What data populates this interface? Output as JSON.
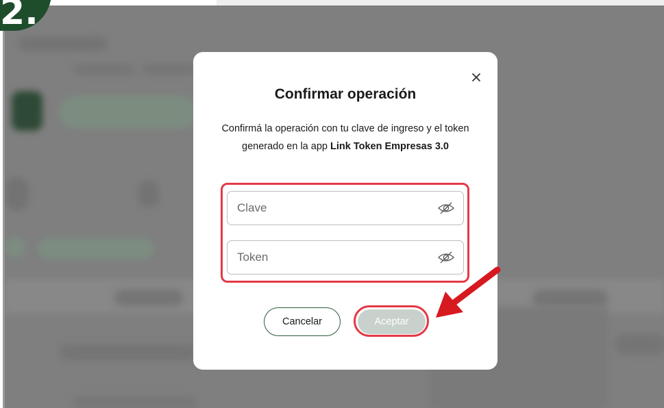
{
  "step_badge": "2.",
  "dialog": {
    "title": "Confirmar operación",
    "description_part1": "Confirmá la operación con tu clave de ingreso y el token generado en la app ",
    "description_bold": "Link Token Empresas 3.0",
    "fields": [
      {
        "placeholder": "Clave",
        "value": "",
        "icon": "eye-off-icon"
      },
      {
        "placeholder": "Token",
        "value": "",
        "icon": "eye-off-icon"
      }
    ],
    "cancel_label": "Cancelar",
    "accept_label": "Aceptar",
    "close_icon": "close-icon"
  },
  "colors": {
    "overlay": "#7f7f7f",
    "highlight": "#e53946",
    "brand_dark_green": "#1e4d2b",
    "accept_disabled": "#c9d1cc"
  }
}
